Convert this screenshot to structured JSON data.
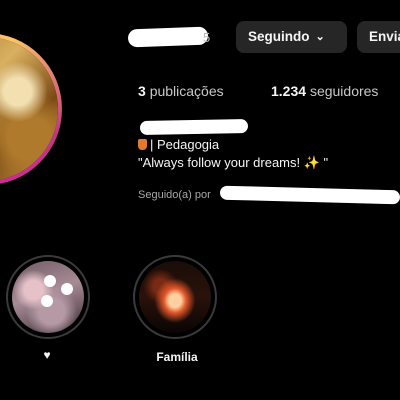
{
  "header": {
    "username_suffix": "5",
    "following_button": "Seguindo",
    "following_chevron": "⌄",
    "message_button": "Enviar mensagem"
  },
  "stats": {
    "posts_count": "3",
    "posts_label": "publicações",
    "followers_count": "1.234",
    "followers_label": "seguidores"
  },
  "bio": {
    "category": "| Pedagogia",
    "quote": "\"Always follow your dreams! ",
    "quote_end": " \"",
    "sparkle": "✨"
  },
  "followed_by": {
    "prefix": "Seguido(a) por"
  },
  "highlights": [
    {
      "label": "♥"
    },
    {
      "label": "Família"
    }
  ]
}
